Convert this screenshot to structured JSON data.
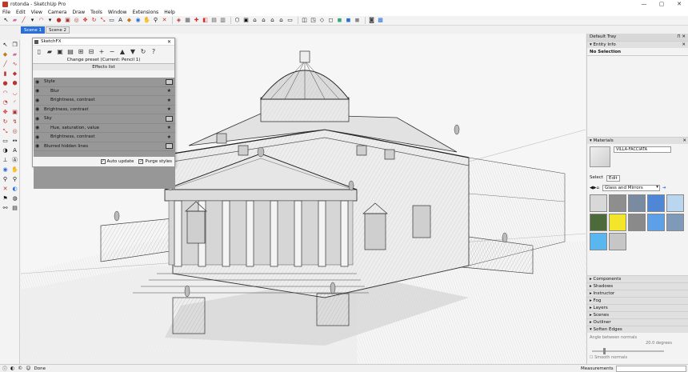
{
  "window": {
    "title": "rotonda - SketchUp Pro",
    "controls": [
      "—",
      "▢",
      "✕"
    ]
  },
  "menu": [
    "File",
    "Edit",
    "View",
    "Camera",
    "Draw",
    "Tools",
    "Window",
    "Extensions",
    "Help"
  ],
  "scenes": [
    {
      "label": "Scene 1",
      "active": true
    },
    {
      "label": "Scene 2",
      "active": false
    }
  ],
  "sketchfx": {
    "title": "SketchFX",
    "close": "✕",
    "preset": "Change preset (Current: Pencil 1)",
    "effects_header": "Effects list",
    "effects": [
      {
        "label": "Style",
        "child": false,
        "icon": "box"
      },
      {
        "label": "Blur",
        "child": true,
        "icon": "star"
      },
      {
        "label": "Brightness, contrast",
        "child": true,
        "icon": "star"
      },
      {
        "label": "Brightness, contrast",
        "child": false,
        "icon": "star"
      },
      {
        "label": "Sky",
        "child": false,
        "icon": "box"
      },
      {
        "label": "Hue, saturation, value",
        "child": true,
        "icon": "star"
      },
      {
        "label": "Brightness, contrast",
        "child": true,
        "icon": "star"
      },
      {
        "label": "Blurred hidden lines",
        "child": false,
        "icon": "box"
      }
    ],
    "auto_update": "Auto update",
    "purge_styles": "Purge styles"
  },
  "tray": {
    "title": "Default Tray",
    "entity_info": "Entity Info",
    "no_selection": "No Selection",
    "materials": "Materials",
    "material_name": "VILLA-FACCIATA",
    "tab_select": "Select",
    "tab_edit": "Edit",
    "library": "Glass and Mirrors",
    "swatches": [
      "#d8d8d8",
      "#8e8e8e",
      "#7a8aa0",
      "#4f86d6",
      "#b9d6ee",
      "#4d6b3a",
      "#f3e62a",
      "#8a8a8a",
      "#5ea0e8",
      "#7f9ab8",
      "#5ab6ee",
      "#c6c6c6"
    ],
    "sections": [
      "Components",
      "Shadows",
      "Instructor",
      "Fog",
      "Layers",
      "Scenes",
      "Outliner",
      "Soften Edges"
    ],
    "soften_label": "Angle between normals",
    "soften_value": "20.0",
    "soften_unit": "degrees",
    "smooth_normals": "Smooth normals"
  },
  "status": {
    "text": "Done",
    "measurements": "Measurements"
  },
  "colors": {
    "accent": "#2a6fd6",
    "fx_list_bg": "#979797"
  }
}
